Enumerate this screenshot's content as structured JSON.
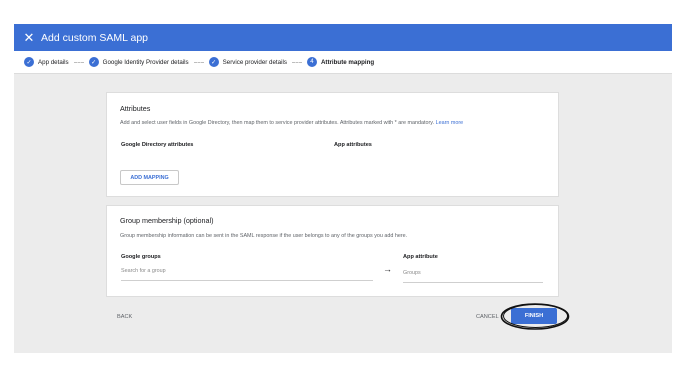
{
  "header": {
    "title": "Add custom SAML app",
    "close_icon": "close-icon",
    "color": "#3b6fd4"
  },
  "stepper": {
    "steps": [
      {
        "label": "App details",
        "marker": "✓"
      },
      {
        "label": "Google Identity Provider details",
        "marker": "✓"
      },
      {
        "label": "Service provider details",
        "marker": "✓"
      },
      {
        "label": "Attribute mapping",
        "marker": "4"
      }
    ]
  },
  "attributes": {
    "title": "Attributes",
    "description": "Add and select user fields in Google Directory, then map them to service provider attributes. Attributes marked with * are mandatory.",
    "learn_more": "Learn more",
    "col_directory": "Google Directory attributes",
    "col_app": "App attributes",
    "add_mapping": "ADD MAPPING"
  },
  "group": {
    "title": "Group membership (optional)",
    "description": "Group membership information can be sent in the SAML response if the user belongs to any of the groups you add here.",
    "col_groups": "Google groups",
    "groups_placeholder": "Search for a group",
    "arrow": "→",
    "col_app_attr": "App attribute",
    "app_attr_placeholder": "Groups"
  },
  "footer": {
    "back": "BACK",
    "cancel": "CANCEL",
    "finish": "FINISH"
  }
}
